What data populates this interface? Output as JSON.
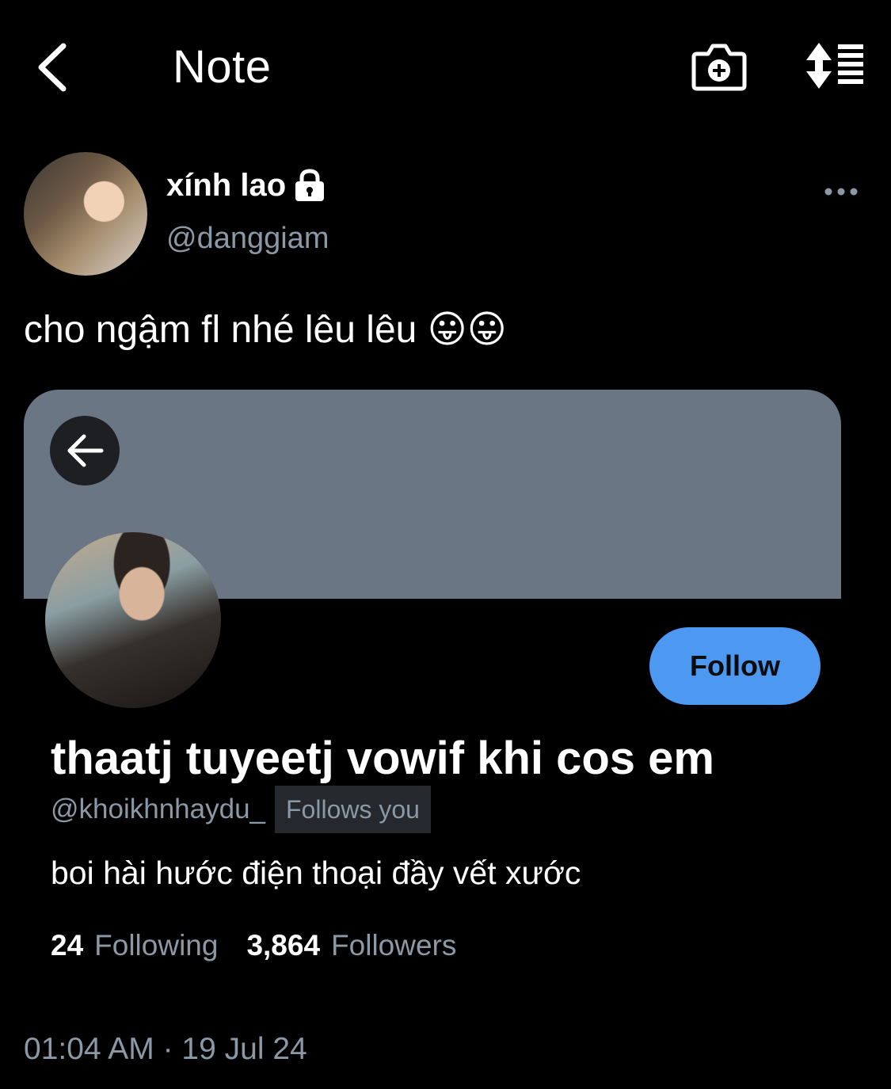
{
  "header": {
    "title": "Note",
    "back_icon": "chevron-left-icon",
    "camera_icon": "camera-plus-icon",
    "sort_icon": "sort-list-icon"
  },
  "author": {
    "name": "xính lao",
    "handle": "@danggiam",
    "lock_icon": "lock-icon",
    "more_icon": "ellipsis-icon"
  },
  "note": {
    "text": "cho ngậm fl nhé lêu lêu 😛😛"
  },
  "card": {
    "banner_color": "#6b7684",
    "back_icon": "arrow-left-icon",
    "follow_label": "Follow",
    "follow_color": "#4d98f0",
    "name": "thaatj tuyeetj vowif khi cos em",
    "handle": "@khoikhnhaydu_",
    "follows_you": "Follows you",
    "bio": "boi hài hước điện thoại đầy vết xước",
    "following_count": "24",
    "following_label": "Following",
    "followers_count": "3,864",
    "followers_label": "Followers"
  },
  "timestamp": "01:04 AM · 19 Jul 24"
}
